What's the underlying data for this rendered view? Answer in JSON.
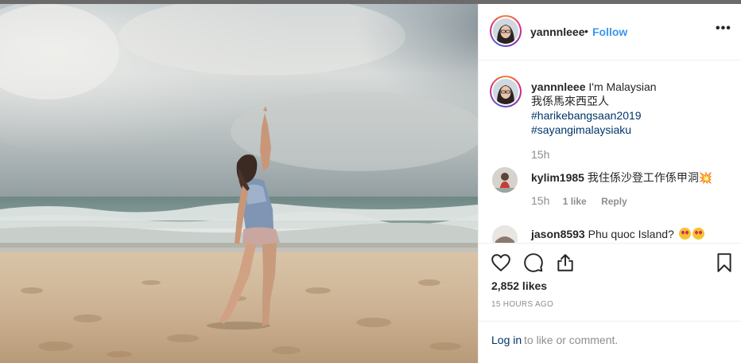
{
  "post": {
    "author": "yannnleee",
    "follow_label": "Follow",
    "dot": "•",
    "more": "•••",
    "caption": {
      "text": "I'm Malaysian",
      "line2": "我係馬來西亞人",
      "hashtags": [
        "#harikebangsaan2019",
        "#sayangimalaysiaku"
      ],
      "time": "15h"
    },
    "comments": [
      {
        "user": "kylim1985",
        "text": "我住係沙登工作係甲洞💥",
        "time": "15h",
        "likes": "1 like",
        "reply": "Reply"
      },
      {
        "user": "jason8593",
        "text": "Phu quoc Island?"
      }
    ],
    "likes": "2,852 likes",
    "ago": "15 HOURS AGO",
    "login": {
      "link": "Log in",
      "rest": "to like or comment."
    }
  },
  "icons": [
    "heart-icon",
    "comment-icon",
    "share-icon",
    "bookmark-icon",
    "more-icon"
  ],
  "colors": {
    "link": "#3897f0",
    "hashtag": "#003569",
    "muted": "#8e8e8e",
    "text": "#262626"
  }
}
